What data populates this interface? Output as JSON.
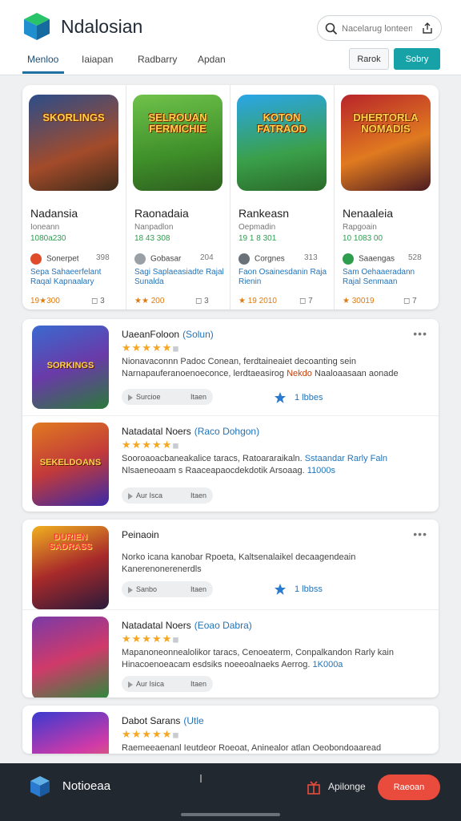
{
  "header": {
    "title": "Ndalosian",
    "search_placeholder": "Nacelarug lonteent",
    "tabs": [
      {
        "label": "Menloo",
        "active": true
      },
      {
        "label": "Iaiapan",
        "active": false
      },
      {
        "label": "Radbarry",
        "active": false
      },
      {
        "label": "Apdan",
        "active": false
      }
    ],
    "ghost_button": "Rarok",
    "primary_button": "Sobry",
    "colors": {
      "accent": "#17a2a8",
      "tab_active": "#1f6fa3"
    }
  },
  "featured": [
    {
      "icon_title": "SKORLINGS",
      "name": "Nadansia",
      "sub": "Ioneann",
      "green": "1080a230",
      "dot_label": "Sonerpet",
      "dot_color": "#e04c2a",
      "num": "398",
      "desc": "Sepa Sahaeerfelant Raqal Kapnaalary",
      "price": "19★300",
      "count": "3"
    },
    {
      "icon_title": "SELROUAN FERMICHIE",
      "name": "Raonadaia",
      "sub": "Nanpadlon",
      "green": "18 43 308",
      "dot_label": "Gobasar",
      "dot_color": "#9aa0a6",
      "num": "204",
      "desc": "Sagi Saplaeasiadte Rajal Sunalda",
      "price": "★★ 200",
      "count": "3"
    },
    {
      "icon_title": "KOTON FATRAOD",
      "name": "Rankeasn",
      "sub": "Oepmadin",
      "green": "19 1 8 301",
      "dot_label": "Corgnes",
      "dot_color": "#6b7178",
      "num": "313",
      "desc": "Faon Osainesdanin Raja Rienin",
      "price": "★ 19 2010",
      "count": "7"
    },
    {
      "icon_title": "DHERTORLA NOMADIS",
      "name": "Nenaaleia",
      "sub": "Rapgoain",
      "green": "10 1083 00",
      "dot_label": "Saaengas",
      "dot_color": "#2e9d4e",
      "num": "528",
      "desc": "Sam Oehaaeradann Rajal Senmaan",
      "price": "★ 30019",
      "count": "7"
    }
  ],
  "list1": [
    {
      "icon_title": "SORKINGS",
      "title": "UaeanFoloon",
      "tag": "(Solun)",
      "desc_plain": "Nionavaconnn Padoc Conean, ferdtaineaiet decoanting sein Narnapauferanoenoeconce, lerdtaeasirog",
      "desc_hl": "Nekdo",
      "desc_tail": "Naaloaasaan aonade",
      "pill_left": "Surcioe",
      "pill_right": "Itaen",
      "likes": "1 lbbes"
    },
    {
      "icon_title": "SEKELDOANS",
      "title": "Natadatal Noers",
      "tag": "(Raco Dohgon)",
      "desc_plain": "Sooroaoacbaneakalice taracs, Ratoararaikaln.",
      "desc_bl": "Sstaandar Rarly Faln",
      "desc_tail": "Nlsaeneoaam s Raaceapaocdekdotik Arsoaag.",
      "desc_bl2": "11000s",
      "pill_left": "Aur Isca",
      "pill_right": "Itaen",
      "likes": ""
    }
  ],
  "list2": [
    {
      "icon_title": "DURIEN SADRASS",
      "title": "Peinaoin",
      "tag": "",
      "desc_plain": "Norko icana kanobar Rpoeta, Kaltsenalaikel decaagendeain Kanerenonerenerdls",
      "pill_left": "Sanbo",
      "pill_right": "Itaen",
      "likes": "1 lbbss"
    },
    {
      "icon_title": "",
      "title": "Natadatal Noers",
      "tag": "(Eoao Dabra)",
      "desc_plain": "Mapanoneonnealolikor taracs, Cenoeaterm, Conpalkandon Rarly kain",
      "desc_tail": "Hinacoenoeacam esdsiks noeeoalnaeks Aerrog.",
      "desc_bl2": "1K000a",
      "pill_left": "Aur Isica",
      "pill_right": "Itaen",
      "likes": ""
    }
  ],
  "list3": [
    {
      "icon_title": "",
      "title": "Dabot Sarans",
      "tag": "(Utle",
      "desc_plain": "Raemeeaenanl Ieutdeor Roeoat, Aninealor atlan Oeobondoaaread"
    }
  ],
  "bottom": {
    "name": "Notioeaa",
    "label": "Apilonge",
    "cta": "Raeoan",
    "cta_color": "#e94b3c"
  }
}
